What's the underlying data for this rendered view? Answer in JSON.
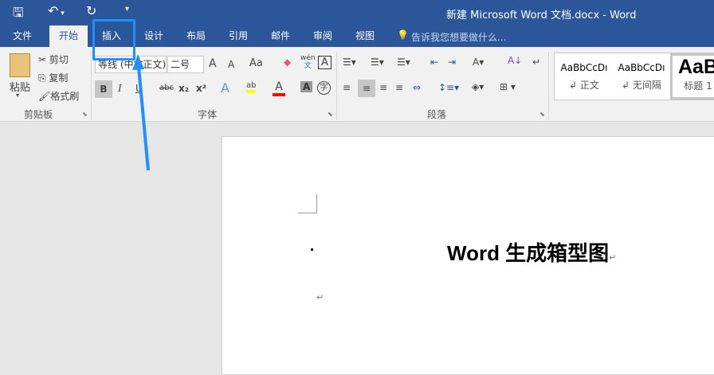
{
  "window": {
    "title": "新建 Microsoft Word 文档.docx - Word"
  },
  "qat": {
    "save_icon": "save-icon",
    "undo_icon": "undo-icon",
    "redo_icon": "redo-icon",
    "customize_icon": "customize-icon"
  },
  "tabs": [
    {
      "label": "文件"
    },
    {
      "label": "开始"
    },
    {
      "label": "插入"
    },
    {
      "label": "设计"
    },
    {
      "label": "布局"
    },
    {
      "label": "引用"
    },
    {
      "label": "邮件"
    },
    {
      "label": "审阅"
    },
    {
      "label": "视图"
    }
  ],
  "tell_me": "告诉我您想要做什么...",
  "clipboard": {
    "paste": "粘贴",
    "cut": "剪切",
    "copy": "复制",
    "format_painter": "格式刷",
    "label": "剪贴板"
  },
  "font": {
    "name": "等线 (中文正文)",
    "size": "二号",
    "grow": "A",
    "shrink": "A",
    "case": "Aa",
    "phonetic_top": "wén",
    "phonetic_bottom": "文",
    "border_char": "A",
    "bold": "B",
    "italic": "I",
    "underline": "U",
    "strike": "abc",
    "sub": "x₂",
    "sup": "x²",
    "effects": "A",
    "highlight": "ab",
    "color": "A",
    "shading": "A",
    "enclose": "字",
    "label": "字体",
    "highlight_color": "#ffff00",
    "font_color": "#ff0000"
  },
  "paragraph": {
    "label": "段落"
  },
  "styles": [
    {
      "preview": "AaBbCcDı",
      "name": "正文"
    },
    {
      "preview": "AaBbCcDı",
      "name": "无间隔"
    },
    {
      "preview": "AaB",
      "name": "标题 1"
    }
  ],
  "document": {
    "heading": "Word 生成箱型图",
    "para_mark": "↵"
  },
  "annotation": {
    "color": "#1e90ff"
  }
}
